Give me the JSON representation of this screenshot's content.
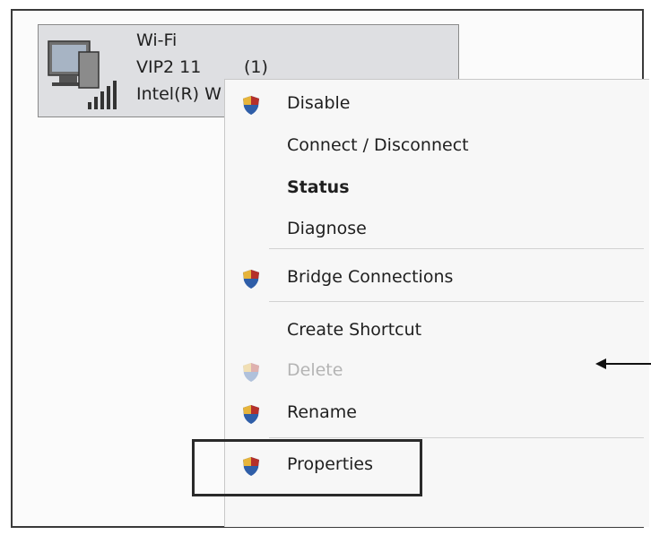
{
  "network": {
    "name": "Wi-Fi",
    "ssid": "VIP2 11",
    "count": "(1)",
    "adapter": "Intel(R) W",
    "icon": "wifi-adapter-icon"
  },
  "context_menu": {
    "items": [
      {
        "label": "Disable",
        "icon": "shield-icon",
        "style": "normal"
      },
      {
        "label": "Connect / Disconnect",
        "icon": null,
        "style": "normal"
      },
      {
        "label": "Status",
        "icon": null,
        "style": "bold"
      },
      {
        "label": "Diagnose",
        "icon": null,
        "style": "normal"
      },
      {
        "label": "Bridge Connections",
        "icon": "shield-icon",
        "style": "normal"
      },
      {
        "label": "Create Shortcut",
        "icon": null,
        "style": "normal"
      },
      {
        "label": "Delete",
        "icon": "shield-icon",
        "style": "disabled"
      },
      {
        "label": "Rename",
        "icon": "shield-icon",
        "style": "normal"
      },
      {
        "label": "Properties",
        "icon": "shield-icon",
        "style": "highlighted"
      }
    ]
  },
  "colors": {
    "shield_blue": "#2f5ea8",
    "shield_red": "#b5302a",
    "shield_yellow": "#e7b43a"
  }
}
